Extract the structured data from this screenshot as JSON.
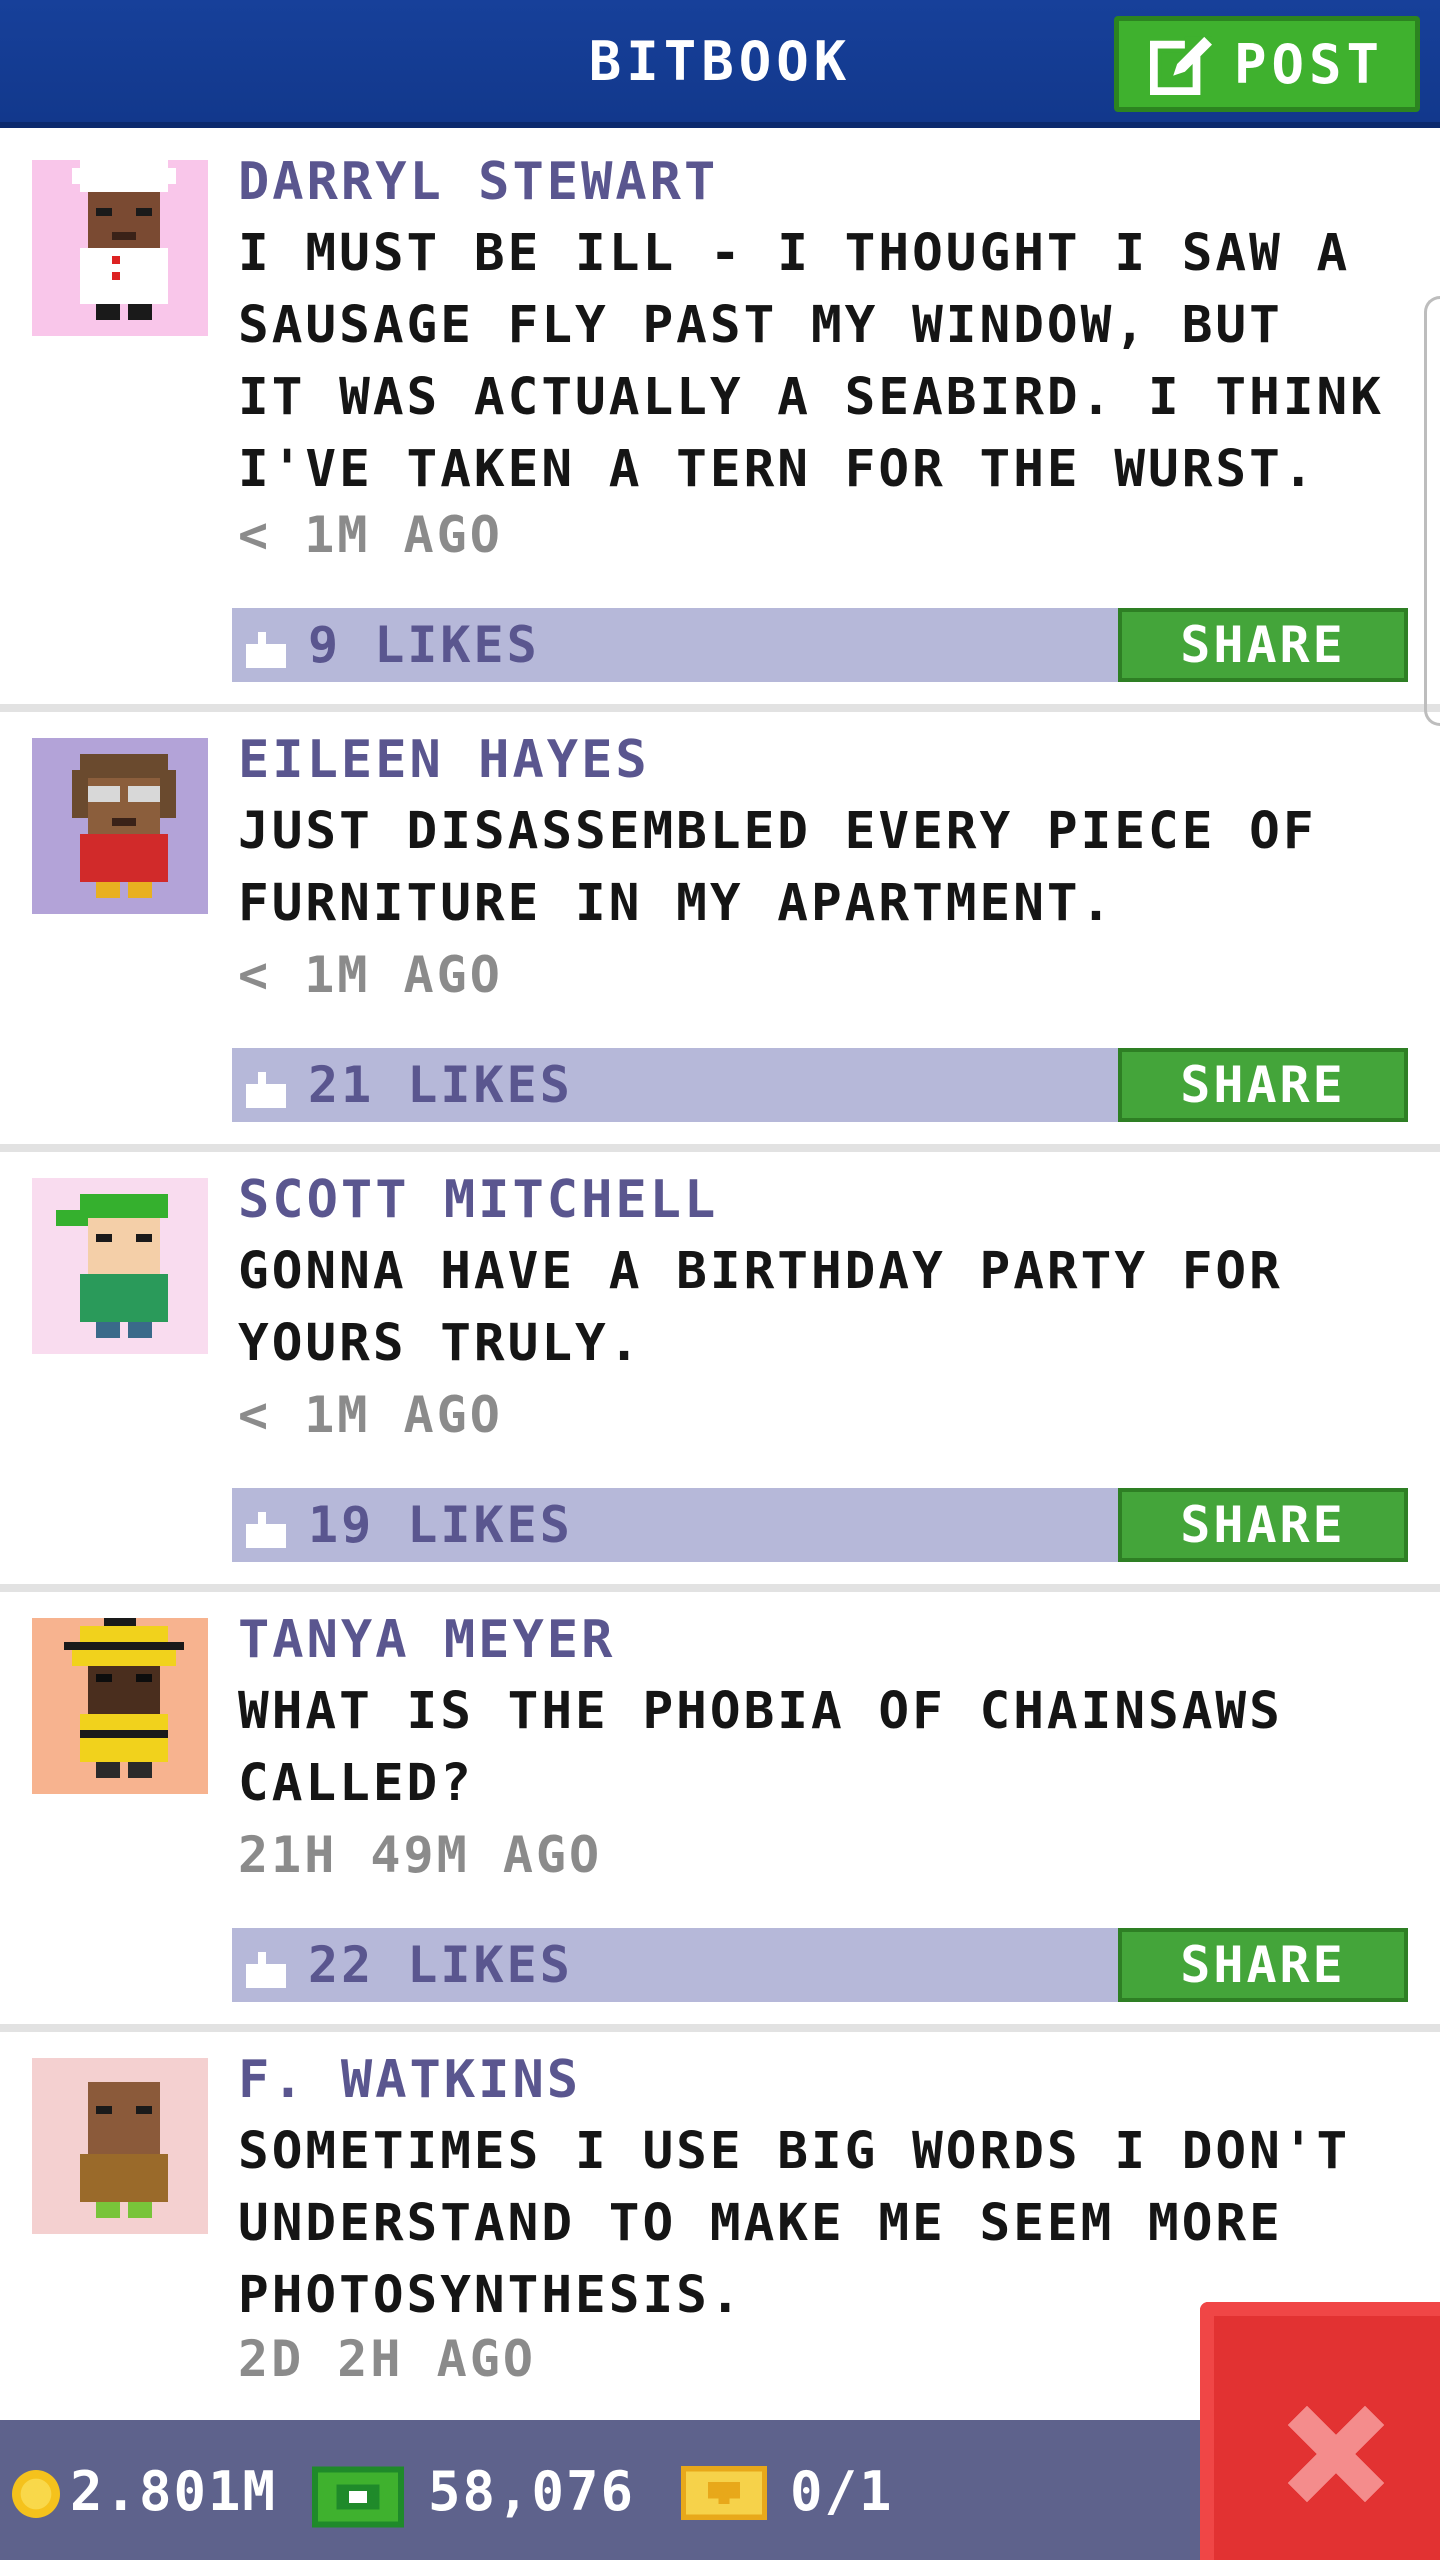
{
  "header": {
    "title": "BITBOOK",
    "post_label": "POST"
  },
  "posts": [
    {
      "author": "DARRYL STEWART",
      "text": "I MUST BE ILL - I THOUGHT I SAW A\nSAUSAGE FLY PAST MY WINDOW, BUT\nIT WAS ACTUALLY A SEABIRD. I THINK\nI'VE TAKEN A TERN FOR THE WURST.",
      "time": "< 1M AGO",
      "likes": "9 LIKES",
      "share": "SHARE",
      "avatar_bg": "#f9c6ea"
    },
    {
      "author": "EILEEN HAYES",
      "text": "JUST DISASSEMBLED EVERY PIECE OF\nFURNITURE IN MY APARTMENT.",
      "time": "< 1M AGO",
      "likes": "21 LIKES",
      "share": "SHARE",
      "avatar_bg": "#b3a3d8"
    },
    {
      "author": "SCOTT MITCHELL",
      "text": "GONNA HAVE A BIRTHDAY PARTY FOR\nYOURS TRULY.",
      "time": "< 1M AGO",
      "likes": "19 LIKES",
      "share": "SHARE",
      "avatar_bg": "#f9dcef"
    },
    {
      "author": "TANYA MEYER",
      "text": "WHAT IS THE PHOBIA OF CHAINSAWS\nCALLED?",
      "time": "21H 49M AGO",
      "likes": "22 LIKES",
      "share": "SHARE",
      "avatar_bg": "#f7b38f"
    },
    {
      "author": "F. WATKINS",
      "text": "SOMETIMES I USE BIG WORDS I DON'T\nUNDERSTAND TO MAKE ME SEEM MORE\nPHOTOSYNTHESIS.",
      "time": "2D 2H AGO",
      "avatar_bg": "#f4d0d0"
    }
  ],
  "bottom_bar": {
    "coins": "2.801M",
    "bux": "58,076",
    "tickets": "0/1"
  },
  "colors": {
    "header": "#17409a",
    "post_button": "#3fb12e",
    "share_button": "#44a53a",
    "like_bar": "#b6b8d9",
    "author_text": "#5a568f",
    "close_button": "#e23232"
  }
}
